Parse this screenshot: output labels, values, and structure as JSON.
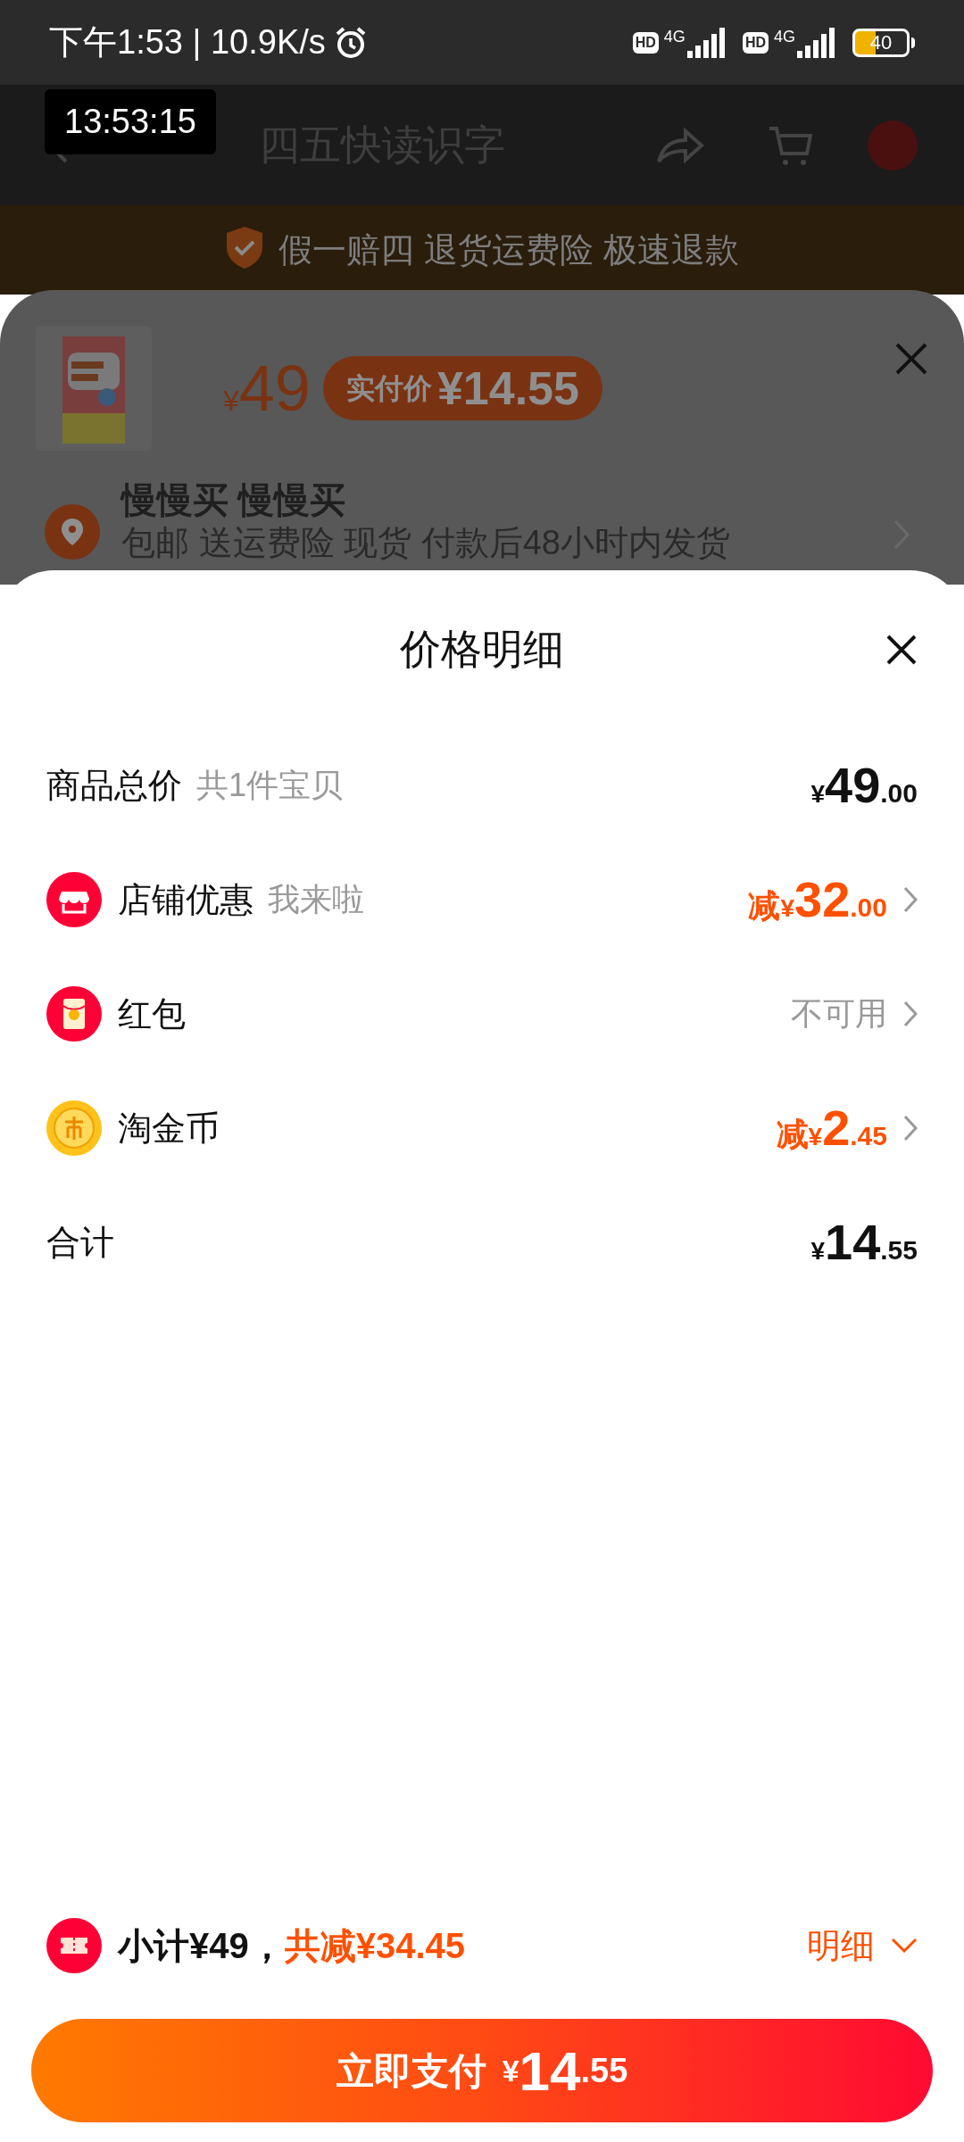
{
  "status_bar": {
    "time_speed": "下午1:53 | 10.9K/s",
    "sims": [
      {
        "hd": "HD",
        "network": "4G"
      },
      {
        "hd": "HD",
        "network": "4G"
      }
    ],
    "battery": "40"
  },
  "time_overlay": "13:53:15",
  "header": {
    "title": "四五快读识字"
  },
  "guarantee": "假一赔四 退货运费险 极速退款",
  "product_sheet": {
    "price": "¥49",
    "badge_label": "实付价",
    "badge_price": "¥14.55",
    "address_name": "慢慢买 慢慢买",
    "shipping": "包邮 送运费险 现货 付款后48小时内发货"
  },
  "price_sheet": {
    "title": "价格明细",
    "rows": [
      {
        "kind": "goods_total",
        "label": "商品总价",
        "note": "共1件宝贝",
        "value": "¥49.00",
        "chevron": false
      },
      {
        "kind": "shop_discount",
        "label": "店铺优惠",
        "note": "我来啦",
        "value": "减¥32.00",
        "chevron": true
      },
      {
        "kind": "red_packet",
        "label": "红包",
        "value": "不可用",
        "chevron": true
      },
      {
        "kind": "coins",
        "label": "淘金币",
        "value": "减¥2.45",
        "chevron": true
      },
      {
        "kind": "sum",
        "label": "合计",
        "value": "¥14.55",
        "chevron": false
      }
    ]
  },
  "summary": {
    "subtotal": "小计¥49，",
    "discount": "共减¥34.45",
    "details_link": "明细",
    "expanded": false
  },
  "pay_button": {
    "label": "立即支付",
    "amount": "¥14.55"
  }
}
